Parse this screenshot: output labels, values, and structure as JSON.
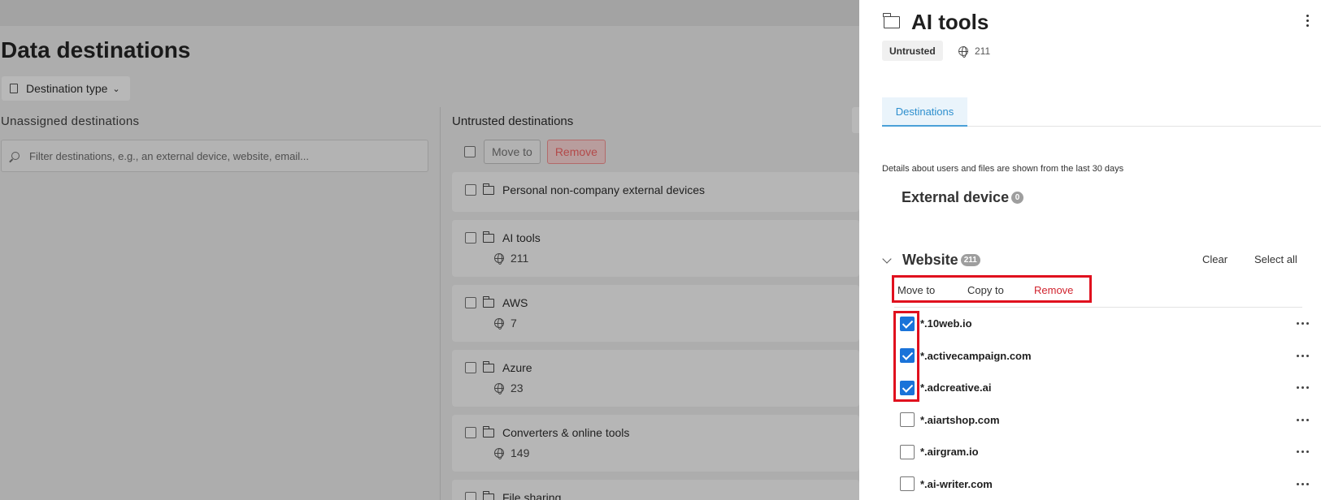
{
  "background": {
    "title": "Data destinations",
    "filter_label": "Destination type",
    "unassigned_heading": "Unassigned destinations",
    "search_placeholder": "Filter destinations, e.g., an external device, website, email...",
    "untrusted_heading": "Untrusted destinations",
    "move_to_label": "Move to",
    "remove_label": "Remove",
    "groups": [
      {
        "name": "Personal non-company external devices",
        "count": ""
      },
      {
        "name": "AI tools",
        "count": "211"
      },
      {
        "name": "AWS",
        "count": "7"
      },
      {
        "name": "Azure",
        "count": "23"
      },
      {
        "name": "Converters & online tools",
        "count": "149"
      },
      {
        "name": "File sharing",
        "count": ""
      }
    ]
  },
  "drawer": {
    "title": "AI tools",
    "tag": "Untrusted",
    "site_count": "211",
    "tab_label": "Destinations",
    "details_note": "Details about users and files are shown from the last 30 days",
    "external_device": {
      "label": "External device",
      "count": "0"
    },
    "website": {
      "label": "Website",
      "count": "211",
      "clear_label": "Clear",
      "select_all_label": "Select all"
    },
    "bulk_actions": {
      "move_to": "Move to",
      "copy_to": "Copy to",
      "remove": "Remove"
    },
    "sites": [
      {
        "domain": "*.10web.io",
        "checked": true
      },
      {
        "domain": "*.activecampaign.com",
        "checked": true
      },
      {
        "domain": "*.adcreative.ai",
        "checked": true
      },
      {
        "domain": "*.aiartshop.com",
        "checked": false
      },
      {
        "domain": "*.airgram.io",
        "checked": false
      },
      {
        "domain": "*.ai-writer.com",
        "checked": false
      }
    ]
  },
  "colors": {
    "accent": "#2e8fce",
    "checkbox_checked": "#1a73d9",
    "remove_red": "#d1242f",
    "highlight_red": "#e0101e"
  }
}
